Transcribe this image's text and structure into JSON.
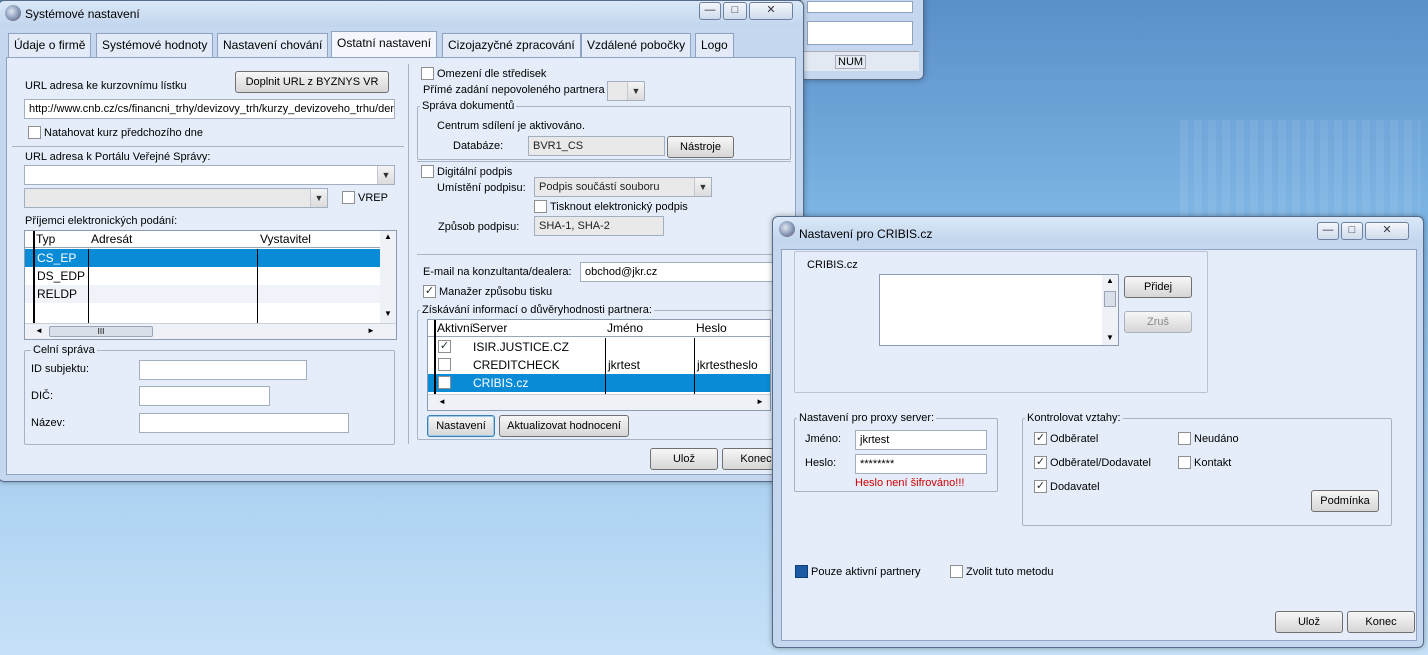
{
  "bg_window": {
    "status_num": "NUM"
  },
  "main_window": {
    "title": "Systémové nastavení",
    "tabs": [
      "Údaje o firmě",
      "Systémové hodnoty",
      "Nastavení chování",
      "Ostatní nastavení",
      "Cizojazyčné zpracování",
      "Vzdálené pobočky",
      "Logo"
    ],
    "active_tab": "Ostatní nastavení",
    "left": {
      "url_kurz_label": "URL adresa ke kurzovnímu lístku",
      "doplnit_button": "Doplnit URL z BYZNYS VR",
      "url_kurz_value": "http://www.cnb.cz/cs/financni_trhy/devizovy_trh/kurzy_devizoveho_trhu/denni_kurz.txt",
      "natahovat_label": "Natahovat kurz předchozího dne",
      "url_portal_label": "URL adresa k Portálu Veřejné Správy:",
      "url_portal_value": "",
      "vrep_label": "VREP",
      "prijemci_label": "Příjemci elektronických podání:",
      "grid_headers": [
        "Typ",
        "Adresát",
        "Vystavitel"
      ],
      "grid_rows": [
        {
          "typ": "CS_EP",
          "adresat": "",
          "vystavitel": ""
        },
        {
          "typ": "DS_EDP",
          "adresat": "",
          "vystavitel": ""
        },
        {
          "typ": "RELDP",
          "adresat": "",
          "vystavitel": ""
        }
      ],
      "scroll_thumb_glyph": "III",
      "celni_title": "Celní správa",
      "id_subjektu_label": "ID subjektu:",
      "dic_label": "DIČ:",
      "nazev_label": "Název:"
    },
    "right": {
      "omezeni_label": "Omezení dle středisek",
      "prime_zadani_label": "Přímé zadání nepovoleného partnera",
      "sprava_title": "Správa dokumentů",
      "centrum_text": "Centrum sdílení je aktivováno.",
      "databaze_label": "Databáze:",
      "databaze_value": "BVR1_CS",
      "nastroje_button": "Nástroje",
      "digitalni_label": "Digitální podpis",
      "umisteni_label": "Umístění podpisu:",
      "umisteni_value": "Podpis součástí souboru",
      "tisknout_label": "Tisknout elektronický podpis",
      "zpusob_label": "Způsob podpisu:",
      "zpusob_value": "SHA-1, SHA-2",
      "email_label": "E-mail na konzultanta/dealera:",
      "email_value": "obchod@jkr.cz",
      "manazer_label": "Manažer způsobu tisku",
      "ziskavani_title": "Získávání informací o důvěryhodnosti partnera:",
      "grid_headers": [
        "Aktivní",
        "Server",
        "Jméno",
        "Heslo"
      ],
      "grid_rows": [
        {
          "aktivni": true,
          "server": "ISIR.JUSTICE.CZ",
          "jmeno": "",
          "heslo": ""
        },
        {
          "aktivni": false,
          "server": "CREDITCHECK",
          "jmeno": "jkrtest",
          "heslo": "jkrtestheslo"
        },
        {
          "aktivni": false,
          "server": "CRIBIS.cz",
          "jmeno": "",
          "heslo": ""
        }
      ],
      "nastaveni_button": "Nastavení",
      "aktualizovat_button": "Aktualizovat hodnocení"
    },
    "uloz_button": "Ulož",
    "konec_button": "Konec"
  },
  "cribis_window": {
    "title": "Nastavení pro CRIBIS.cz",
    "list_title": "CRIBIS.cz",
    "pridej_button": "Přidej",
    "zrus_button": "Zruš",
    "proxy_title": "Nastavení pro proxy server:",
    "jmeno_label": "Jméno:",
    "jmeno_value": "jkrtest",
    "heslo_label": "Heslo:",
    "heslo_value": "********",
    "heslo_warning": "Heslo není šifrováno!!!",
    "kontrolovat_title": "Kontrolovat vztahy:",
    "odberatel": "Odběratel",
    "odberatel_dodavatel": "Odběratel/Dodavatel",
    "dodavatel": "Dodavatel",
    "neudano": "Neudáno",
    "kontakt": "Kontakt",
    "podminka_button": "Podmínka",
    "pouze_aktivni": "Pouze aktivní partnery",
    "zvolit_metodu": "Zvolit tuto metodu",
    "uloz_button": "Ulož",
    "konec_button": "Konec"
  },
  "glyphs": {
    "check": "✓",
    "arrow_down": "▼",
    "arrow_up": "▲",
    "arrow_left": "◄",
    "arrow_right": "►",
    "minimize": "—",
    "maximize": "□",
    "close": "✕"
  }
}
